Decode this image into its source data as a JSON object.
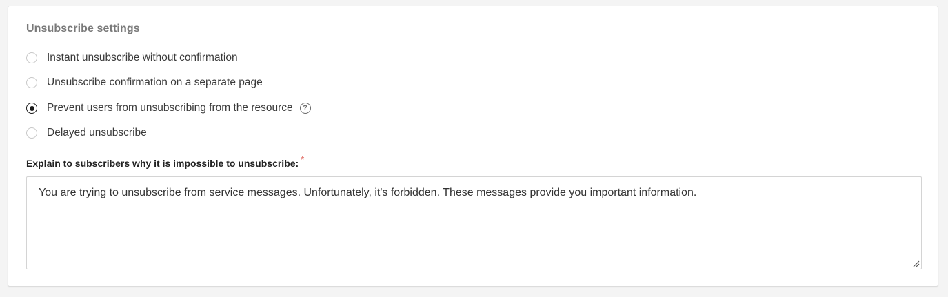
{
  "settings": {
    "title": "Unsubscribe settings",
    "options": [
      {
        "label": "Instant unsubscribe without confirmation",
        "checked": false
      },
      {
        "label": "Unsubscribe confirmation on a separate page",
        "checked": false
      },
      {
        "label": "Prevent users from unsubscribing from the resource",
        "checked": true
      },
      {
        "label": "Delayed unsubscribe",
        "checked": false
      }
    ],
    "help_icon": "question-circle-icon"
  },
  "explanation": {
    "label": "Explain to subscribers why it is impossible to unsubscribe:",
    "required_mark": "*",
    "value": "You are trying to unsubscribe from service messages. Unfortunately, it's forbidden. These messages provide you important information."
  },
  "colors": {
    "required": "#d8443a",
    "title": "#7a7a7a",
    "radio_checked": "#1a1a1a"
  }
}
